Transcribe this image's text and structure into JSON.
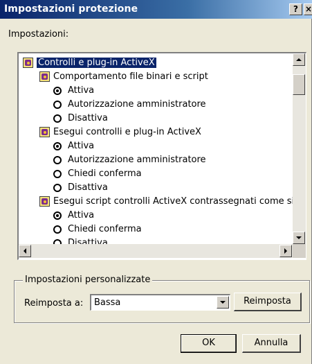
{
  "window": {
    "title": "Impostazioni protezione",
    "help_label": "?",
    "close_label": "×"
  },
  "settings_label": "Impostazioni:",
  "tree": {
    "root": "Controlli e plug-in ActiveX",
    "groups": [
      {
        "label": "Comportamento file binari e script",
        "options": [
          "Attiva",
          "Autorizzazione amministratore",
          "Disattiva"
        ],
        "selected": 0
      },
      {
        "label": "Esegui controlli e plug-in ActiveX",
        "options": [
          "Attiva",
          "Autorizzazione amministratore",
          "Chiedi conferma",
          "Disattiva"
        ],
        "selected": 0
      },
      {
        "label": "Esegui script controlli ActiveX contrassegnati come sicur",
        "options": [
          "Attiva",
          "Chiedi conferma",
          "Disattiva"
        ],
        "selected": 0
      }
    ]
  },
  "custom_group": {
    "title": "Impostazioni personalizzate",
    "reset_label": "Reimposta a:",
    "reset_value": "Bassa",
    "reset_button": "Reimposta"
  },
  "buttons": {
    "ok": "OK",
    "cancel": "Annulla"
  }
}
